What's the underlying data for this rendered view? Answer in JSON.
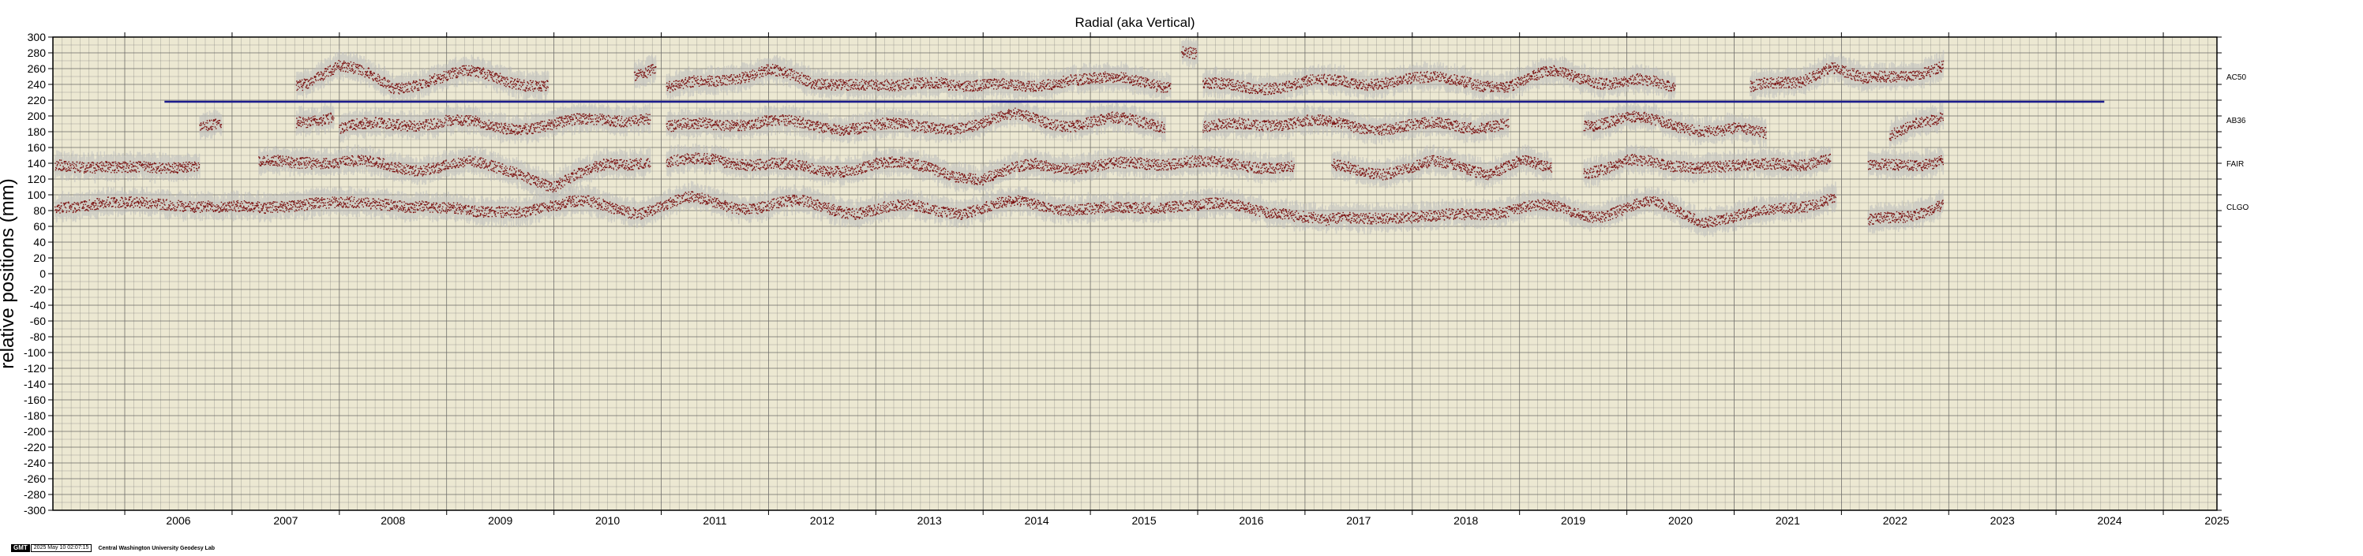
{
  "chart_data": {
    "type": "scatter",
    "title": "Radial (aka Vertical)",
    "ylabel": "relative positions (mm)",
    "xlabel": "",
    "xlim": [
      2005.33,
      2025.5
    ],
    "ylim": [
      -300,
      300
    ],
    "y_major_step": 20,
    "x_ticks": [
      2006,
      2007,
      2008,
      2009,
      2010,
      2011,
      2012,
      2013,
      2014,
      2015,
      2016,
      2017,
      2018,
      2019,
      2020,
      2021,
      2022,
      2023,
      2024,
      2025
    ],
    "grid": true,
    "background_color": "#ece8d2",
    "grid_color": "#6b6b6b",
    "point_color": "#7a0f0f",
    "band_color": "#bcbcbc",
    "series": [
      {
        "name": "AC50",
        "label_y": 250,
        "segments": [
          {
            "x": [
              2007.6,
              2008.0,
              2008.3,
              2008.5,
              2008.9,
              2009.2,
              2009.6,
              2009.95
            ],
            "y": [
              240,
              265,
              250,
              235,
              250,
              255,
              245,
              240
            ]
          },
          {
            "x": [
              2010.75,
              2010.95
            ],
            "y": [
              255,
              262
            ]
          },
          {
            "x": [
              2011.05,
              2011.5,
              2012.0,
              2012.4,
              2012.8,
              2013.2,
              2013.6,
              2014.0,
              2014.4,
              2014.8,
              2015.3,
              2015.75
            ],
            "y": [
              235,
              245,
              260,
              240,
              245,
              235,
              245,
              240,
              235,
              250,
              245,
              240
            ]
          },
          {
            "x": [
              2015.85,
              2016.0
            ],
            "y": [
              285,
              280
            ]
          },
          {
            "x": [
              2016.05,
              2016.5,
              2017.0,
              2017.5,
              2017.9,
              2018.3,
              2018.9,
              2019.3,
              2019.8,
              2020.1,
              2020.45
            ],
            "y": [
              240,
              235,
              245,
              240,
              250,
              245,
              240,
              255,
              245,
              245,
              235
            ]
          },
          {
            "x": [
              2021.15,
              2021.6,
              2021.9,
              2022.2,
              2022.5,
              2022.95
            ],
            "y": [
              235,
              245,
              265,
              245,
              250,
              265
            ]
          }
        ]
      },
      {
        "name": "AB36",
        "label_y": 195,
        "segments": [
          {
            "x": [
              2006.7,
              2006.9
            ],
            "y": [
              190,
              195
            ]
          },
          {
            "x": [
              2007.6,
              2007.95
            ],
            "y": [
              195,
              200
            ]
          },
          {
            "x": [
              2008.0,
              2008.5,
              2009.0,
              2009.5,
              2009.9,
              2010.5,
              2010.9
            ],
            "y": [
              185,
              190,
              195,
              185,
              190,
              195,
              200
            ]
          },
          {
            "x": [
              2011.05,
              2011.5,
              2012.0,
              2012.5,
              2013.0,
              2013.4,
              2013.9,
              2014.3,
              2014.8,
              2015.2,
              2015.7
            ],
            "y": [
              185,
              190,
              195,
              185,
              190,
              185,
              190,
              200,
              190,
              195,
              190
            ]
          },
          {
            "x": [
              2016.05,
              2016.5,
              2017.0,
              2017.5,
              2018.0,
              2018.5,
              2018.9
            ],
            "y": [
              185,
              190,
              195,
              185,
              190,
              185,
              195
            ]
          },
          {
            "x": [
              2019.6,
              2020.0,
              2020.5,
              2021.0,
              2021.3
            ],
            "y": [
              190,
              200,
              185,
              185,
              175
            ]
          },
          {
            "x": [
              2022.45,
              2022.7,
              2022.95
            ],
            "y": [
              175,
              195,
              200
            ]
          }
        ]
      },
      {
        "name": "FAIR",
        "label_y": 140,
        "segments": [
          {
            "x": [
              2005.35,
              2005.8,
              2006.3,
              2006.7
            ],
            "y": [
              135,
              140,
              130,
              140
            ]
          },
          {
            "x": [
              2007.25,
              2007.7,
              2008.2,
              2008.7,
              2009.2,
              2009.7,
              2010.0,
              2010.5,
              2010.9
            ],
            "y": [
              140,
              145,
              140,
              135,
              140,
              130,
              110,
              140,
              145
            ]
          },
          {
            "x": [
              2011.05,
              2011.5,
              2012.0,
              2012.5,
              2013.0,
              2013.5,
              2014.0,
              2014.5,
              2015.0,
              2015.5,
              2015.9,
              2016.4,
              2016.9
            ],
            "y": [
              140,
              145,
              140,
              130,
              140,
              135,
              120,
              140,
              135,
              140,
              145,
              135,
              140
            ]
          },
          {
            "x": [
              2017.25,
              2017.7,
              2018.2,
              2018.7,
              2019.0,
              2019.3
            ],
            "y": [
              135,
              130,
              140,
              130,
              145,
              130
            ]
          },
          {
            "x": [
              2019.6,
              2020.0,
              2020.4,
              2020.8,
              2021.2,
              2021.6,
              2021.9
            ],
            "y": [
              130,
              145,
              135,
              140,
              135,
              140,
              150
            ]
          },
          {
            "x": [
              2022.25,
              2022.6,
              2022.95
            ],
            "y": [
              135,
              140,
              145
            ]
          }
        ]
      },
      {
        "name": "CLGO",
        "label_y": 85,
        "segments": [
          {
            "x": [
              2005.35,
              2005.8,
              2006.3,
              2006.8,
              2007.3,
              2007.8,
              2008.3,
              2008.8,
              2009.3,
              2009.8,
              2010.3,
              2010.8,
              2011.3,
              2011.8,
              2012.3,
              2012.8,
              2013.3,
              2013.8,
              2014.3,
              2014.8,
              2015.3,
              2015.8,
              2016.3,
              2016.8,
              2017.2,
              2017.7,
              2018.2,
              2018.7,
              2019.2,
              2019.7,
              2020.2,
              2020.7,
              2021.2,
              2021.7,
              2021.95
            ],
            "y": [
              80,
              95,
              85,
              90,
              80,
              95,
              85,
              90,
              75,
              85,
              90,
              80,
              95,
              85,
              90,
              80,
              85,
              80,
              90,
              85,
              80,
              90,
              85,
              80,
              65,
              75,
              70,
              80,
              85,
              75,
              90,
              70,
              75,
              90,
              100
            ]
          },
          {
            "x": [
              2022.25,
              2022.6,
              2022.95
            ],
            "y": [
              65,
              75,
              90
            ]
          }
        ]
      }
    ],
    "reference_line": {
      "y": 218,
      "x_start": 2006.37,
      "x_end": 2024.45,
      "color": "#1c1c8c"
    }
  },
  "stamp": {
    "logo": "GMT",
    "timestamp": "2025 May 10 02:07:15",
    "lab": "Central Washington University Geodesy Lab"
  }
}
